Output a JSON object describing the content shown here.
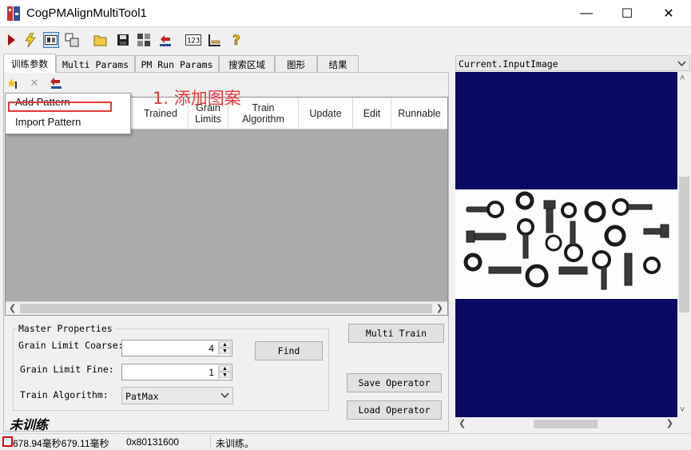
{
  "window": {
    "title": "CogPMAlignMultiTool1"
  },
  "title_buttons": {
    "minimize": "—",
    "maximize": "☐",
    "close": "✕"
  },
  "tabs": [
    "训练参数",
    "Multi Params",
    "PM Run Params",
    "搜索区域",
    "图形",
    "结果"
  ],
  "pattern_toolbar": {
    "close_glyph": "✕"
  },
  "grid": {
    "columns": [
      "Trained",
      "Grain\nLimits",
      "Train\nAlgorithm",
      "Update",
      "Edit",
      "Runnable"
    ]
  },
  "menu": {
    "items": [
      "Add Pattern",
      "Import Pattern"
    ]
  },
  "annotation": "1. 添加图案",
  "master": {
    "title": "Master Properties",
    "coarse_label": "Grain Limit Coarse:",
    "coarse_value": "4",
    "fine_label": "Grain Limit Fine:",
    "fine_value": "1",
    "algo_label": "Train Algorithm:",
    "algo_value": "PatMax"
  },
  "buttons": {
    "find": "Find",
    "multi_train": "Multi Train",
    "save_operator": "Save Operator",
    "load_operator": "Load Operator"
  },
  "train_status": "未训练",
  "image_pane": {
    "title": "Current.InputImage"
  },
  "statusbar": {
    "time": "678.94毫秒679.11毫秒",
    "code": "0x80131600",
    "message": "未训练。"
  },
  "colors": {
    "image_background": "#0a0a64",
    "annotation": "#e8383d",
    "highlight": "#e53935"
  }
}
